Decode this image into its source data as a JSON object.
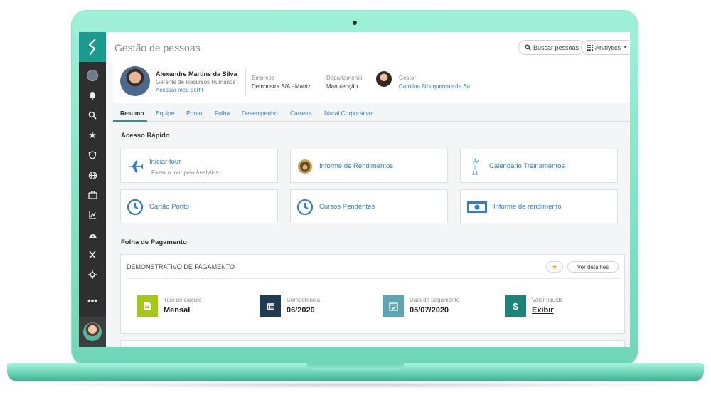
{
  "app": {
    "title": "Gestão de pessoas"
  },
  "header": {
    "search_label": "Buscar pessoas",
    "analytics_label": "Analytics"
  },
  "profile": {
    "name": "Alexandre Martins da Silva",
    "role": "Gerente de Recursos Humanos",
    "link": "Acessar meu perfil",
    "company_label": "Empresa",
    "company_value": "Demonstra S/A - Matriz",
    "department_label": "Departamento",
    "department_value": "Manutenção",
    "manager_label": "Gestor",
    "manager_value": "Carolina Albuquerque de Sá"
  },
  "tabs": [
    "Resumo",
    "Equipe",
    "Ponto",
    "Folha",
    "Desempenho",
    "Carreira",
    "Mural Corporativo"
  ],
  "quick_access": {
    "title": "Acesso Rápido",
    "cards": [
      {
        "title": "Iniciar tour",
        "subtitle": "Fazer o tour pelo Analytics",
        "icon": "airplane-icon"
      },
      {
        "title": "Informe de Rendimentos",
        "icon": "lion-emblem-icon"
      },
      {
        "title": "Calendário Treinamentos",
        "icon": "statue-icon"
      },
      {
        "title": "Cartão Ponto",
        "icon": "clock-icon"
      },
      {
        "title": "Cursos Pendentes",
        "icon": "clock-icon"
      },
      {
        "title": "Informe de rendimento",
        "icon": "banknote-icon"
      }
    ]
  },
  "payroll": {
    "title": "Folha de Pagamento",
    "card_title": "DEMONSTRATIVO DE PAGAMENTO",
    "details_label": "Ver detalhes",
    "items": [
      {
        "label": "Tipo de cálculo",
        "value": "Mensal",
        "color": "#a4c913"
      },
      {
        "label": "Competência",
        "value": "06/2020",
        "color": "#1f3d52"
      },
      {
        "label": "Data de pagamento",
        "value": "05/07/2020",
        "color": "#5aa6b4"
      },
      {
        "label": "Valor líquido",
        "value": "Exibir",
        "color": "#1b8378"
      }
    ]
  },
  "sidebar": {
    "icons": [
      "avatar",
      "bell-icon",
      "search-icon",
      "star-icon",
      "shield-icon",
      "globe-icon",
      "briefcase-icon",
      "chart-icon",
      "gauge-icon",
      "x-icon",
      "crosshair-icon",
      "more-icon"
    ]
  },
  "colors": {
    "brand": "#1b9b8d",
    "link": "#2f80c8",
    "sidebar": "#2f2f2f"
  }
}
